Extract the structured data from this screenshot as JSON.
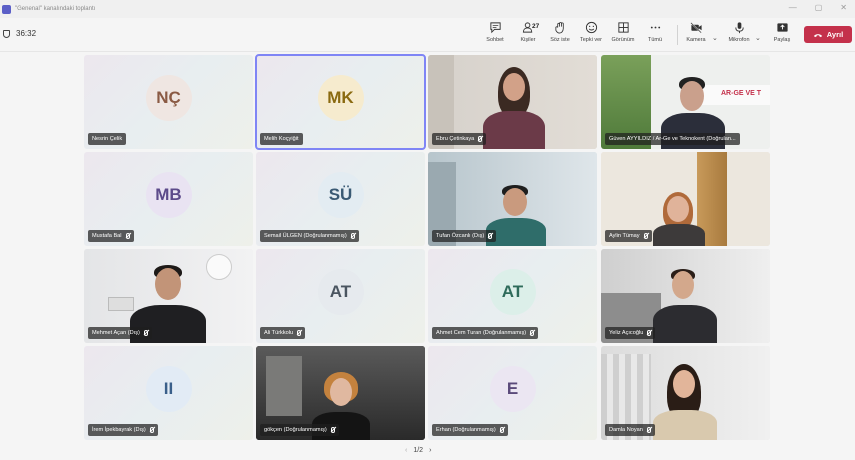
{
  "window": {
    "title": "\"Genenal\" kanalındaki toplantı"
  },
  "meeting": {
    "timer": "36:32"
  },
  "toolbar": {
    "chat": "Sohbet",
    "people": "Kişiler",
    "people_count": "27",
    "raise": "Söz iste",
    "react": "Tepki ver",
    "view": "Görünüm",
    "more": "Tümü",
    "camera": "Kamera",
    "mic": "Mikrofon",
    "share": "Paylaş",
    "leave": "Ayrıl"
  },
  "tiles": [
    {
      "name": "Nesrin Çelik",
      "initials": "NÇ",
      "avatar_bg": "#efe6e2",
      "avatar_fg": "#8a5a44",
      "muted": false
    },
    {
      "name": "Melih Koçyiğit",
      "initials": "MK",
      "avatar_bg": "#f6ebce",
      "avatar_fg": "#8a6a10",
      "muted": false
    },
    {
      "name": "Ebru Çetinkaya",
      "initials": "",
      "muted": true
    },
    {
      "name": "Güven AYYILDIZ / Ar-Ge ve Teknokent (Doğrulan...",
      "initials": "",
      "muted": false
    },
    {
      "name": "Mustafa Bal",
      "initials": "MB",
      "avatar_bg": "#e9e3f2",
      "avatar_fg": "#5c4a8a",
      "muted": true
    },
    {
      "name": "Semail ÜLGEN (Doğrulanmamış)",
      "initials": "SÜ",
      "avatar_bg": "#e3ecf2",
      "avatar_fg": "#3a5a74",
      "muted": true
    },
    {
      "name": "Tufan Özcanlı (Dış)",
      "initials": "",
      "muted": true
    },
    {
      "name": "Aylin Tümay",
      "initials": "",
      "muted": true
    },
    {
      "name": "Mehmet Açan (Dış)",
      "initials": "",
      "muted": true
    },
    {
      "name": "Ali Türkkolu",
      "initials": "AT",
      "avatar_bg": "#e6eaee",
      "avatar_fg": "#4a5560",
      "muted": true
    },
    {
      "name": "Ahmet Cem Turan (Doğrulanmamış)",
      "initials": "AT",
      "avatar_bg": "#dcefe9",
      "avatar_fg": "#2e6b5a",
      "muted": true
    },
    {
      "name": "Yeliz Açıcoğlu",
      "initials": "",
      "muted": true
    },
    {
      "name": "İrem İpekbayrak (Dış)",
      "initials": "II",
      "avatar_bg": "#e2ebf5",
      "avatar_fg": "#3a5f8a",
      "muted": true
    },
    {
      "name": "gökçen (Doğrulanmamış)",
      "initials": "",
      "muted": true
    },
    {
      "name": "Erhan (Doğrulanmamış)",
      "initials": "E",
      "avatar_bg": "#ebe6f2",
      "avatar_fg": "#5a4a7a",
      "muted": true
    },
    {
      "name": "Damla Noyan",
      "initials": "",
      "muted": true
    }
  ],
  "pager": {
    "text": "1/2"
  },
  "logo_text": "AR-GE VE T"
}
